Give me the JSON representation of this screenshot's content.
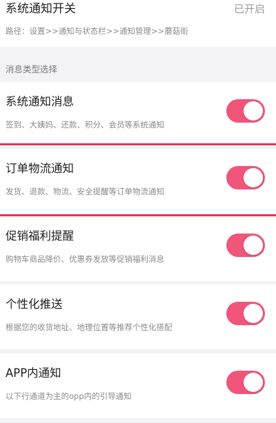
{
  "header": {
    "title": "系统通知开关",
    "status": "已开启",
    "path": "路径：设置>>通知与状态栏>>通知管理>>蘑菇街"
  },
  "section": {
    "label": "消息类型选择"
  },
  "settings": [
    {
      "title": "系统通知消息",
      "desc": "签到、大姨妈、还款、积分、会员等系统通知",
      "enabled": true
    },
    {
      "title": "订单物流通知",
      "desc": "发货、退款、物流、安全提醒等订单物流通知",
      "enabled": true
    },
    {
      "title": "促销福利提醒",
      "desc": "购物车商品降价、优惠券发放等促销福利消息",
      "enabled": true
    },
    {
      "title": "个性化推送",
      "desc": "根据您的收货地址、地理位置等推荐个性化搭配",
      "enabled": true
    },
    {
      "title": "APP内通知",
      "desc": "以下行通道为主的opp内的引导通知",
      "enabled": true
    }
  ],
  "colors": {
    "toggle_on": "#f0557a",
    "highlight": "#e8354d",
    "background": "#f3f3f5"
  }
}
